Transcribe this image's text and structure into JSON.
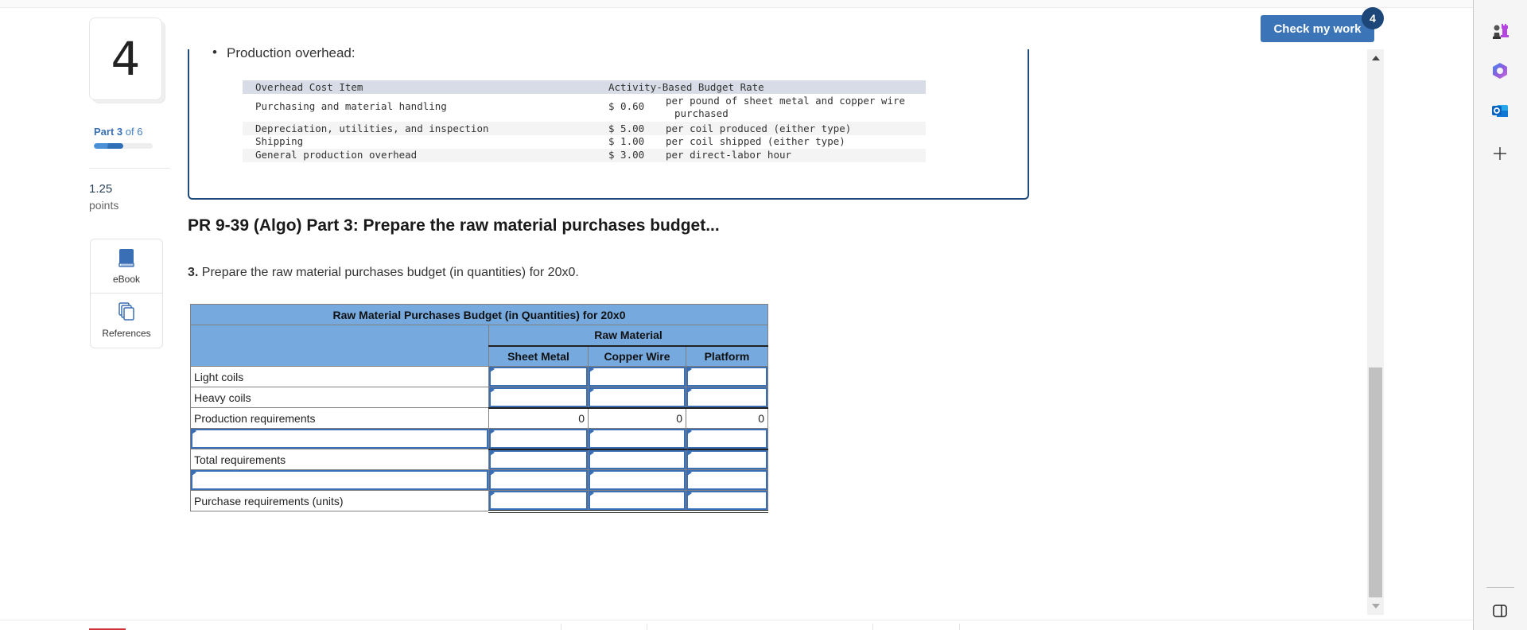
{
  "question": {
    "number": "4",
    "part_label_bold": "Part 3",
    "part_label_rest": "of 6",
    "progress_fraction": 0.5,
    "points_value": "1.25",
    "points_label": "points"
  },
  "tools": {
    "ebook_label": "eBook",
    "references_label": "References"
  },
  "info": {
    "bullet": "Production overhead:",
    "overhead_table": {
      "headers": [
        "Overhead Cost Item",
        "Activity-Based Budget Rate"
      ],
      "rows": [
        {
          "item": "Purchasing and material handling",
          "amount": "$ 0.60",
          "desc": "per pound of sheet metal and copper wire",
          "desc2": "purchased"
        },
        {
          "item": "Depreciation, utilities, and inspection",
          "amount": "$ 5.00",
          "desc": "per coil produced (either type)"
        },
        {
          "item": "Shipping",
          "amount": "$ 1.00",
          "desc": "per coil shipped (either type)"
        },
        {
          "item": "General production overhead",
          "amount": "$ 3.00",
          "desc": "per direct-labor hour"
        }
      ]
    }
  },
  "problem": {
    "title": "PR 9-39 (Algo) Part 3: Prepare the raw material purchases budget...",
    "instruction_num": "3.",
    "instruction_text": " Prepare the raw material purchases budget (in quantities) for 20x0."
  },
  "budget_table": {
    "title": "Raw Material Purchases Budget (in Quantities) for 20x0",
    "group_header": "Raw Material",
    "columns": [
      "Sheet Metal",
      "Copper Wire",
      "Platform"
    ],
    "rows": [
      {
        "label": "Light coils",
        "label_input": false,
        "values": [
          "",
          "",
          ""
        ],
        "editable": true
      },
      {
        "label": "Heavy coils",
        "label_input": false,
        "values": [
          "",
          "",
          ""
        ],
        "editable": true
      },
      {
        "label": "Production requirements",
        "label_input": false,
        "values": [
          "0",
          "0",
          "0"
        ],
        "editable": false
      },
      {
        "label": "",
        "label_input": true,
        "values": [
          "",
          "",
          ""
        ],
        "editable": true
      },
      {
        "label": "Total requirements",
        "label_input": false,
        "values": [
          "",
          "",
          ""
        ],
        "editable": true
      },
      {
        "label": "",
        "label_input": true,
        "values": [
          "",
          "",
          ""
        ],
        "editable": true
      },
      {
        "label": "Purchase requirements (units)",
        "label_input": false,
        "values": [
          "",
          "",
          ""
        ],
        "editable": true
      }
    ]
  },
  "header": {
    "check_button": "Check my work",
    "check_badge": "4"
  },
  "browser_sidebar": {
    "icons": [
      "chess-icon",
      "copilot-icon",
      "outlook-icon",
      "add-icon",
      "sidebar-toggle-icon"
    ]
  }
}
